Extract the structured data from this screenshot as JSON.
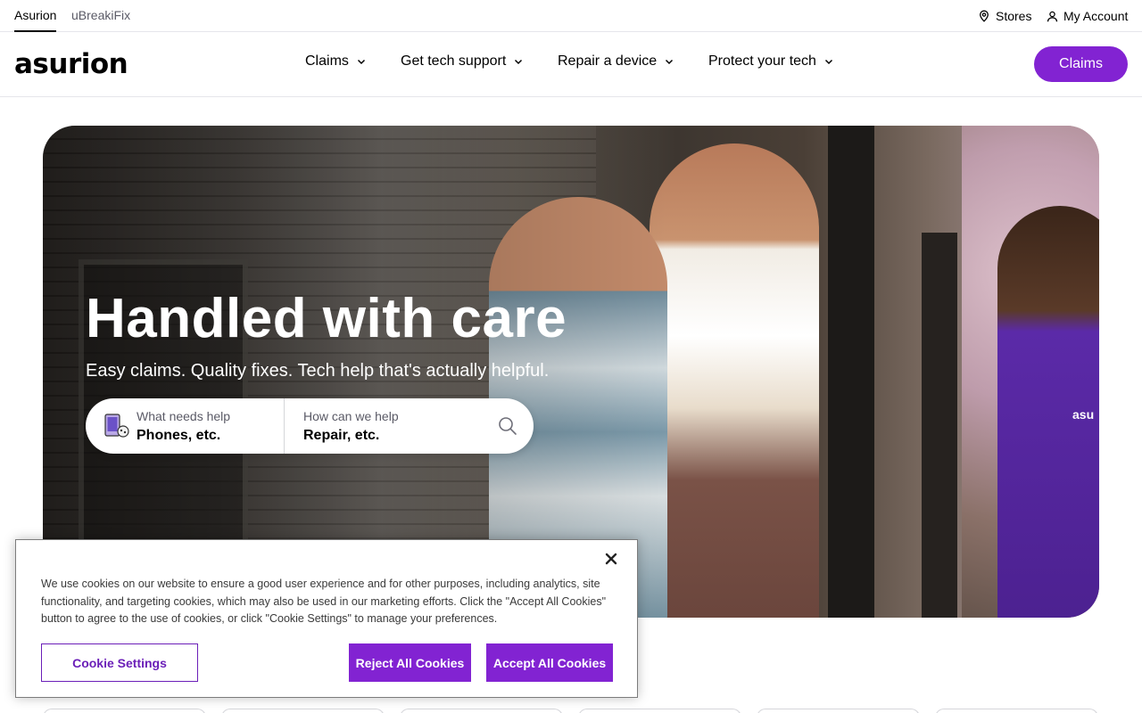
{
  "utility_bar": {
    "tabs": [
      {
        "label": "Asurion",
        "active": true
      },
      {
        "label": "uBreakiFix",
        "active": false
      }
    ],
    "stores_label": "Stores",
    "account_label": "My Account"
  },
  "header": {
    "logo_text": "asurion",
    "nav": [
      {
        "label": "Claims"
      },
      {
        "label": "Get tech support"
      },
      {
        "label": "Repair a device"
      },
      {
        "label": "Protect your tech"
      }
    ],
    "claims_button": "Claims"
  },
  "hero": {
    "title": "Handled with care",
    "subtitle": "Easy claims. Quality fixes. Tech help that's actually helpful.",
    "badge_text": "asu",
    "search": {
      "device_label": "What needs help",
      "device_value": "Phones, etc.",
      "help_label": "How can we help",
      "help_value": "Repair, etc."
    }
  },
  "cookie_banner": {
    "text": "We use cookies on our website to ensure a good user experience and for other purposes, including analytics, site functionality, and targeting cookies, which may also be used in our marketing efforts. Click the \"Accept All Cookies\" button to agree to the use of cookies, or click \"Cookie Settings\" to manage your preferences.",
    "settings_button": "Cookie Settings",
    "reject_button": "Reject All Cookies",
    "accept_button": "Accept All Cookies"
  },
  "colors": {
    "brand_purple": "#8223d2",
    "text_primary": "#000000",
    "text_secondary": "#5a5a66"
  }
}
